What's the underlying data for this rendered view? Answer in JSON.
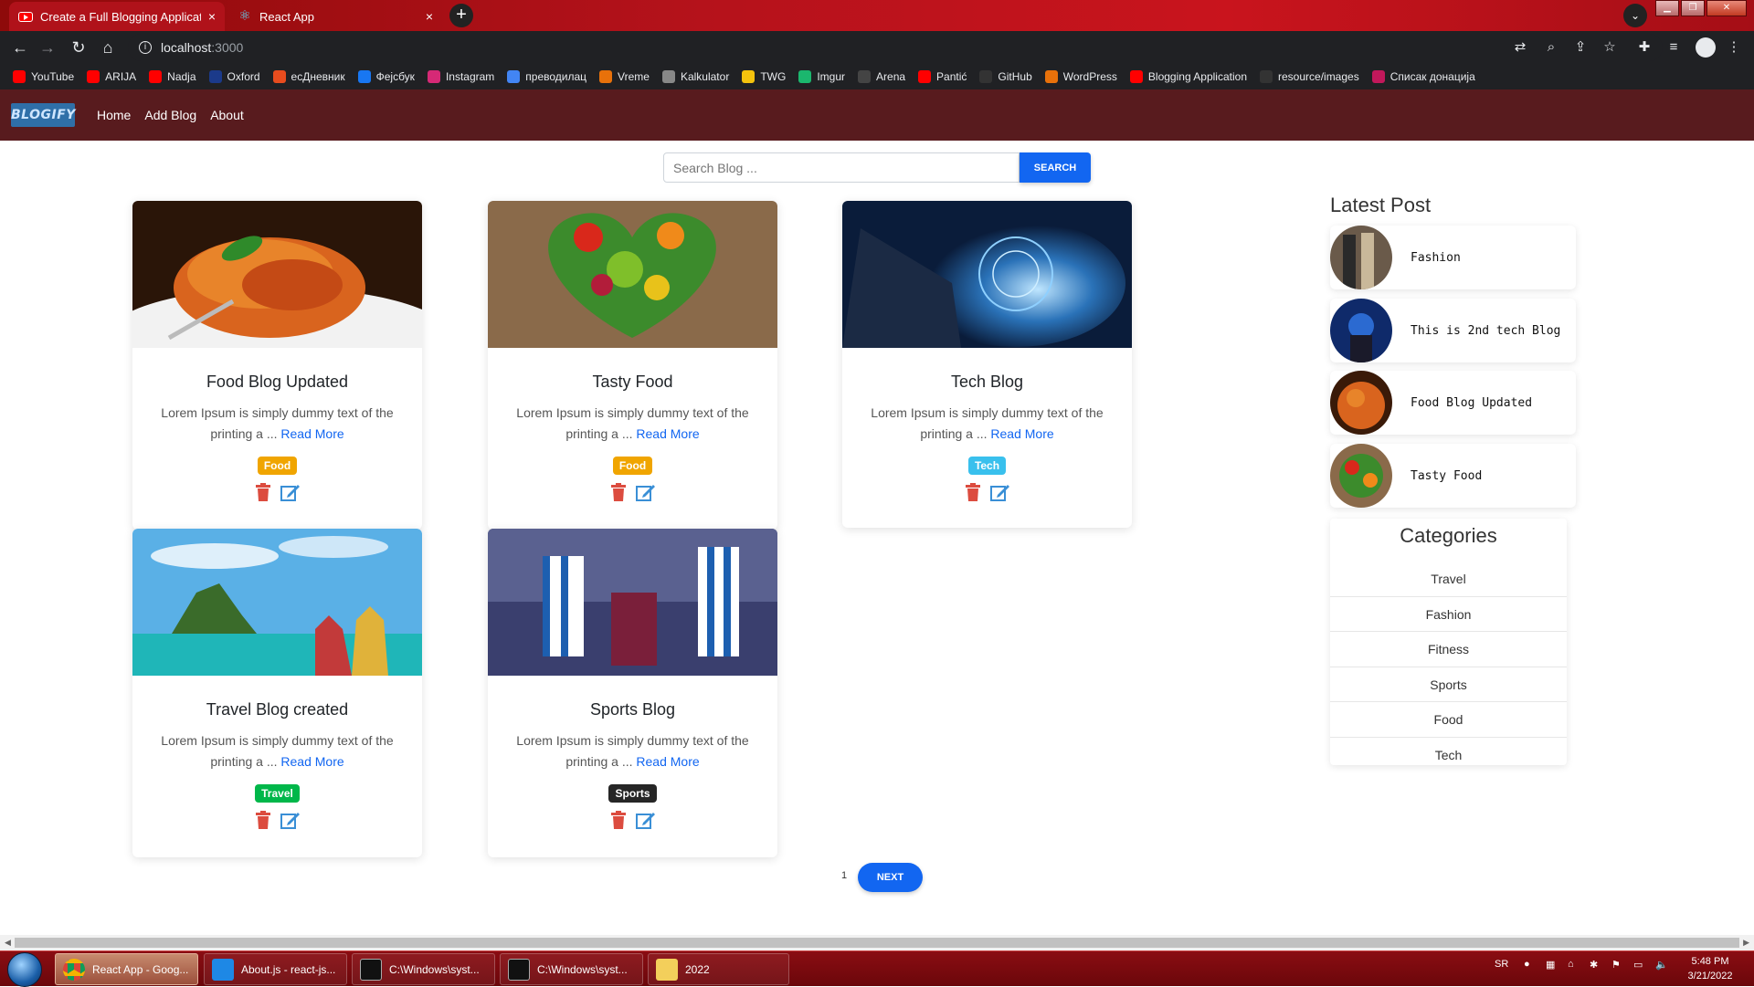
{
  "browser": {
    "tabs": [
      {
        "title": "Create a Full Blogging Applicatio",
        "close": "×"
      },
      {
        "title": "React App",
        "close": "×"
      }
    ],
    "new_tab": "+",
    "url_host": "localhost",
    "url_port": ":3000",
    "bookmarks": [
      {
        "label": "YouTube",
        "color": "#ff0000"
      },
      {
        "label": "ARIJA",
        "color": "#ff0000"
      },
      {
        "label": "Nadja",
        "color": "#ff0000"
      },
      {
        "label": "Oxford",
        "color": "#1b3a8a"
      },
      {
        "label": "есДневник",
        "color": "#e84c1e"
      },
      {
        "label": "Фејсбук",
        "color": "#1877f2"
      },
      {
        "label": "Instagram",
        "color": "#d62976"
      },
      {
        "label": "преводилац",
        "color": "#4285f4"
      },
      {
        "label": "Vreme",
        "color": "#e8710a"
      },
      {
        "label": "Kalkulator",
        "color": "#888888"
      },
      {
        "label": "TWG",
        "color": "#f4c20d"
      },
      {
        "label": "Imgur",
        "color": "#1bb76e"
      },
      {
        "label": "Arena",
        "color": "#444444"
      },
      {
        "label": "Pantić",
        "color": "#ff0000"
      },
      {
        "label": "GitHub",
        "color": "#333333"
      },
      {
        "label": "WordPress",
        "color": "#e8710a"
      },
      {
        "label": "Blogging Application",
        "color": "#ff0000"
      },
      {
        "label": "resource/images",
        "color": "#333333"
      },
      {
        "label": "Списак донација",
        "color": "#c2185b"
      }
    ]
  },
  "app": {
    "logo": "BLOGIFY",
    "nav": [
      "Home",
      "Add Blog",
      "About"
    ],
    "search": {
      "placeholder": "Search Blog ...",
      "button": "SEARCH"
    },
    "cards": [
      {
        "title": "Food Blog Updated",
        "excerpt": "Lorem Ipsum is simply dummy text of the printing a ...",
        "read_more": "Read More",
        "category": "Food",
        "badge_color": "#f0a500"
      },
      {
        "title": "Tasty Food",
        "excerpt": "Lorem Ipsum is simply dummy text of the printing a ...",
        "read_more": "Read More",
        "category": "Food",
        "badge_color": "#f0a500"
      },
      {
        "title": "Tech Blog",
        "excerpt": "Lorem Ipsum is simply dummy text of the printing a ...",
        "read_more": "Read More",
        "category": "Tech",
        "badge_color": "#39c0ed"
      },
      {
        "title": "Travel Blog created",
        "excerpt": "Lorem Ipsum is simply dummy text of the printing a ...",
        "read_more": "Read More",
        "category": "Travel",
        "badge_color": "#00b74a"
      },
      {
        "title": "Sports Blog",
        "excerpt": "Lorem Ipsum is simply dummy text of the printing a ...",
        "read_more": "Read More",
        "category": "Sports",
        "badge_color": "#262626"
      }
    ],
    "sidebar": {
      "latest_title": "Latest Post",
      "latest": [
        "Fashion",
        "This is 2nd tech Blog",
        "Food Blog Updated",
        "Tasty Food"
      ],
      "categories_title": "Categories",
      "categories": [
        "Travel",
        "Fashion",
        "Fitness",
        "Sports",
        "Food",
        "Tech"
      ]
    },
    "pagination": {
      "page": "1",
      "next": "NEXT"
    }
  },
  "taskbar": {
    "items": [
      {
        "label": "React App - Goog..."
      },
      {
        "label": "About.js - react-js..."
      },
      {
        "label": "C:\\Windows\\syst..."
      },
      {
        "label": "C:\\Windows\\syst..."
      },
      {
        "label": "2022"
      }
    ],
    "lang": "SR",
    "time": "5:48 PM",
    "date": "3/21/2022"
  }
}
